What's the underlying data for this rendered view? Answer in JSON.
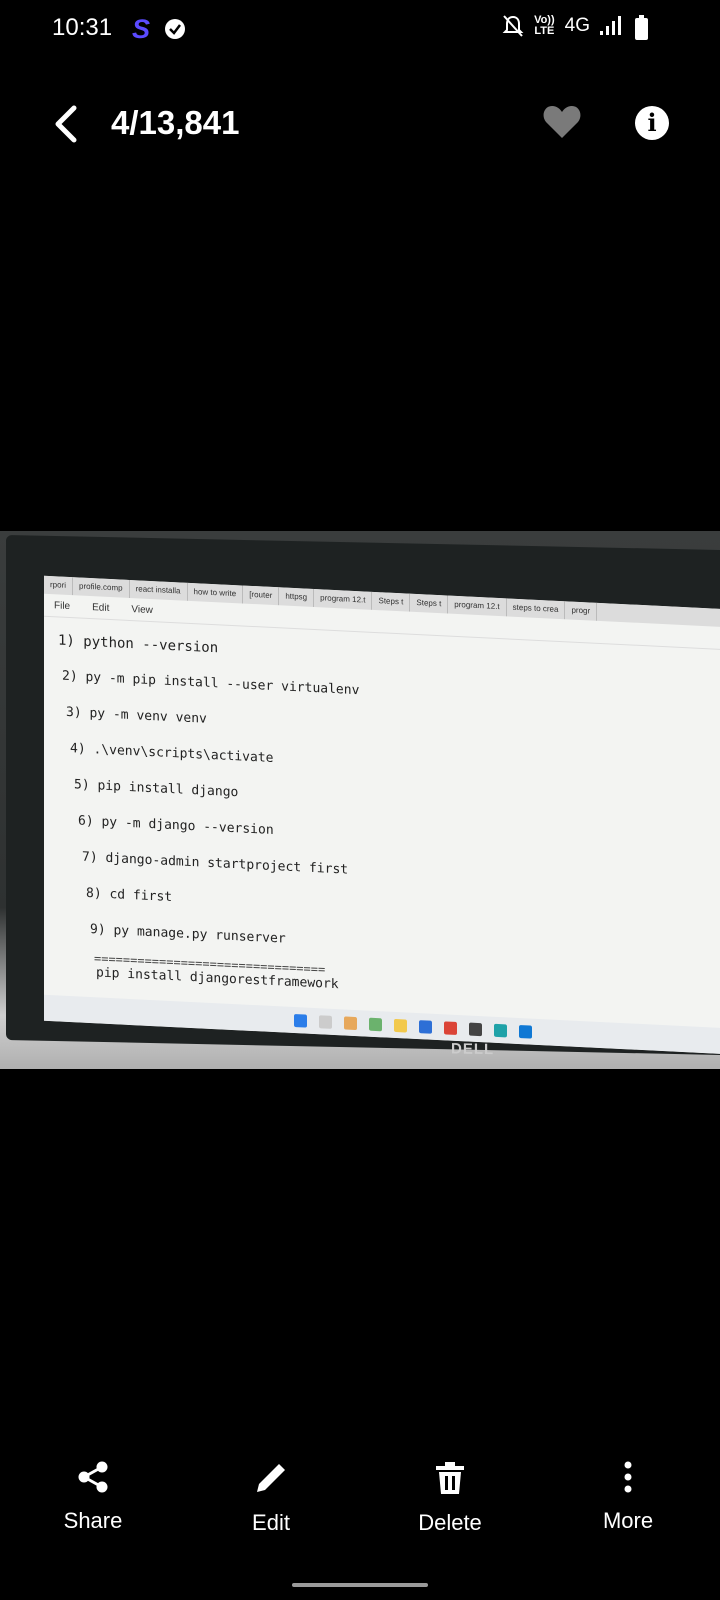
{
  "status_bar": {
    "time": "10:31",
    "network": "4G",
    "lte_top": "Vo))",
    "lte_bottom": "LTE"
  },
  "header": {
    "counter": "4/13,841"
  },
  "photo": {
    "tabs": [
      "rpori",
      "profile.comp",
      "react installa",
      "how to write",
      "[router",
      "httpsg",
      "program 12.t",
      "Steps t",
      "Steps t",
      "program 12.t",
      "steps to crea",
      "progr"
    ],
    "menu": [
      "File",
      "Edit",
      "View"
    ],
    "code_lines": [
      "1) python --version",
      "2) py -m pip install --user virtualenv",
      "3) py -m venv venv",
      "4) .\\venv\\scripts\\activate",
      "5) pip install django",
      "6) py -m django --version",
      "7) django-admin startproject first",
      "8) cd first",
      "9) py manage.py runserver"
    ],
    "separator": "================================",
    "last_line": "pip install djangorestframework",
    "brand": "DELL"
  },
  "actions": [
    {
      "label": "Share",
      "icon": "share-icon"
    },
    {
      "label": "Edit",
      "icon": "edit-icon"
    },
    {
      "label": "Delete",
      "icon": "delete-icon"
    },
    {
      "label": "More",
      "icon": "more-icon"
    }
  ]
}
